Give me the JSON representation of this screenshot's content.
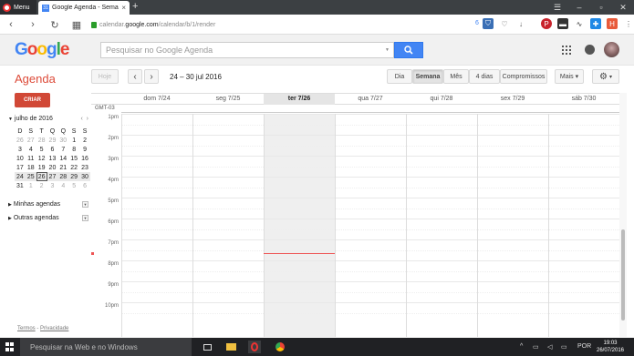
{
  "browser": {
    "menu_label": "Menu",
    "tab_title": "Google Agenda - Semana",
    "tab_favicon_text": "31",
    "url_prefix": "calendar.",
    "url_domain": "google.com",
    "url_path": "/calendar/b/1/render",
    "ext_badge": "6"
  },
  "header": {
    "search_placeholder": "Pesquisar no Google Agenda"
  },
  "toolbar": {
    "app_title": "Agenda",
    "today_label": "Hoje",
    "prev_label": "‹",
    "next_label": "›",
    "date_range": "24 – 30 jul 2016",
    "views": [
      {
        "label": "Dia",
        "active": false
      },
      {
        "label": "Semana",
        "active": true
      },
      {
        "label": "Mês",
        "active": false
      },
      {
        "label": "4 dias",
        "active": false
      },
      {
        "label": "Compromissos",
        "active": false
      }
    ],
    "more_label": "Mais ▾",
    "settings_caret": "▾"
  },
  "sidebar": {
    "create_label": "CRIAR",
    "mini_month": "julho de 2016",
    "mini_weekdays": [
      "D",
      "S",
      "T",
      "Q",
      "Q",
      "S",
      "S"
    ],
    "mini_weeks": [
      [
        "26",
        "27",
        "28",
        "29",
        "30",
        "1",
        "2"
      ],
      [
        "3",
        "4",
        "5",
        "6",
        "7",
        "8",
        "9"
      ],
      [
        "10",
        "11",
        "12",
        "13",
        "14",
        "15",
        "16"
      ],
      [
        "17",
        "18",
        "19",
        "20",
        "21",
        "22",
        "23"
      ],
      [
        "24",
        "25",
        "26",
        "27",
        "28",
        "29",
        "30"
      ],
      [
        "31",
        "1",
        "2",
        "3",
        "4",
        "5",
        "6"
      ]
    ],
    "my_calendars": "Minhas agendas",
    "other_calendars": "Outras agendas",
    "terms": "Termos",
    "privacy": "Privacidade",
    "separator": " - "
  },
  "calendar": {
    "timezone": "GMT-03",
    "days": [
      {
        "label": "dom 7/24",
        "today": false
      },
      {
        "label": "seg 7/25",
        "today": false
      },
      {
        "label": "ter 7/26",
        "today": true
      },
      {
        "label": "qua 7/27",
        "today": false
      },
      {
        "label": "qui 7/28",
        "today": false
      },
      {
        "label": "sex 7/29",
        "today": false
      },
      {
        "label": "sáb 7/30",
        "today": false
      }
    ],
    "hours": [
      "1pm",
      "2pm",
      "3pm",
      "4pm",
      "5pm",
      "6pm",
      "7pm",
      "8pm",
      "9pm",
      "10pm"
    ]
  },
  "taskbar": {
    "search_placeholder": "Pesquisar na Web e no Windows",
    "lang": "POR",
    "time": "19:03",
    "date": "26/07/2016"
  }
}
